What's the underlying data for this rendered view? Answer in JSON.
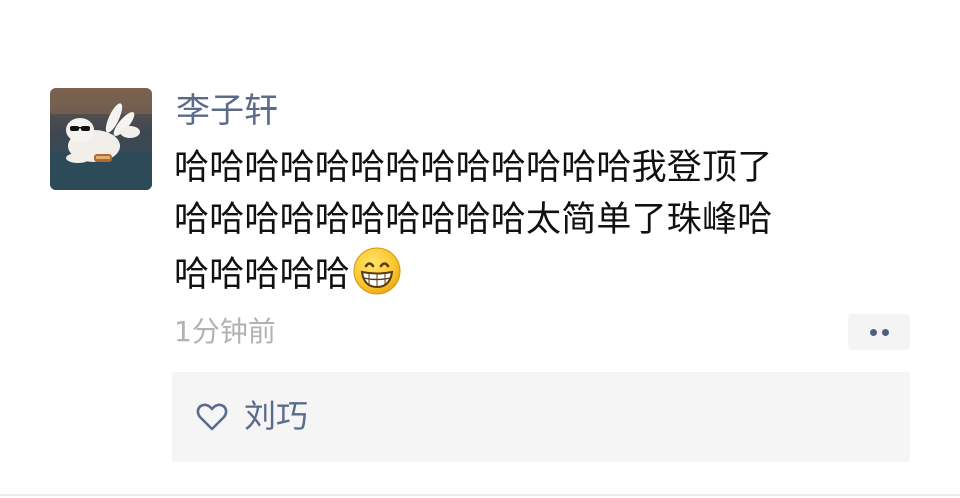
{
  "post": {
    "username": "李子轩",
    "content_lines": [
      "哈哈哈哈哈哈哈哈哈哈哈哈哈我登顶了",
      "哈哈哈哈哈哈哈哈哈哈太简单了珠峰哈",
      "哈哈哈哈哈"
    ],
    "emoji": "grinning-face-emoji",
    "timestamp": "1分钟前"
  },
  "likes": {
    "icon": "heart-outline-icon",
    "names": "刘巧"
  },
  "more_button": {
    "icon": "two-dots-icon"
  },
  "colors": {
    "name_link": "#5b6b8c",
    "text": "#111111",
    "timestamp": "#b2b2b2",
    "panel_bg": "#f5f5f5"
  }
}
